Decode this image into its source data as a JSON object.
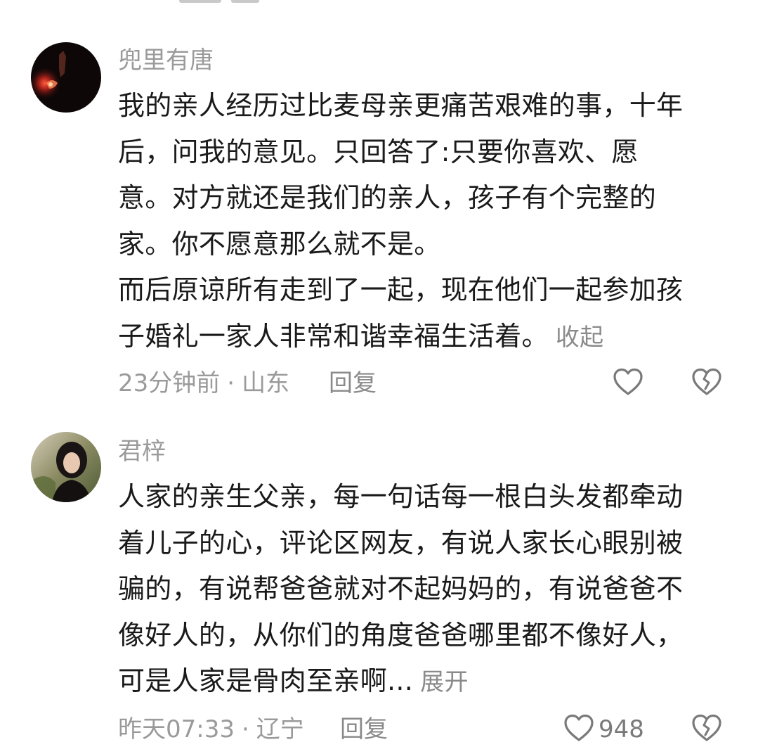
{
  "comments": [
    {
      "username": "兜里有唐",
      "paragraphs": [
        "我的亲人经历过比麦母亲更痛苦艰难的事，十年",
        "后，问我的意见。只回答了:只要你喜欢、愿",
        "意。对方就还是我们的亲人，孩子有个完整的",
        "家。你不愿意那么就不是。",
        "而后原谅所有走到了一起，现在他们一起参加孩",
        "子婚礼一家人非常和谐幸福生活着。"
      ],
      "toggle_label": "收起",
      "time": "23分钟前",
      "location": "山东",
      "separator": "·",
      "reply_label": "回复",
      "like_count": "",
      "avatar_icon": "avatar-dark-night-photo"
    },
    {
      "username": "君梓",
      "paragraphs": [
        "人家的亲生父亲，每一句话每一根白头发都牵动",
        "着儿子的心，评论区网友，有说人家长心眼别被",
        "骗的，有说帮爸爸就对不起妈妈的，有说爸爸不",
        "像好人的，从你们的角度爸爸哪里都不像好人，",
        "可是人家是骨肉至亲啊..."
      ],
      "toggle_label": "展开",
      "time": "昨天07:33",
      "location": "辽宁",
      "separator": "·",
      "reply_label": "回复",
      "like_count": "948",
      "avatar_icon": "avatar-woman-portrait"
    }
  ],
  "icons": {
    "like": "heart-outline-icon",
    "dislike": "broken-heart-outline-icon"
  },
  "colors": {
    "text": "#1a1a1a",
    "muted": "#9a9a9a",
    "icon": "#7a7a7a"
  }
}
